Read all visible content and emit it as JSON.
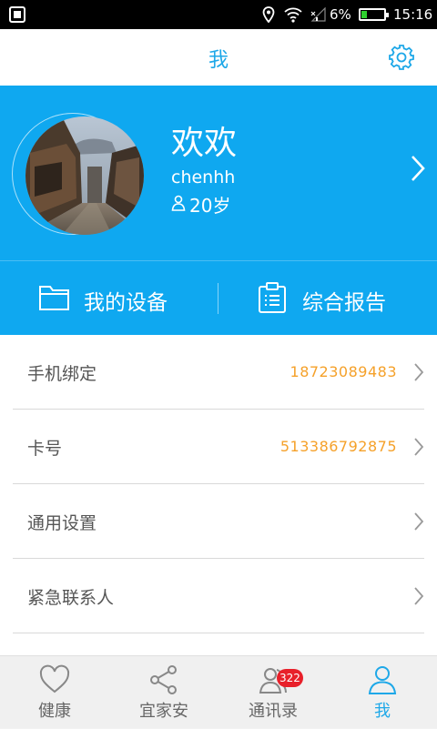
{
  "status_bar": {
    "battery": "6%",
    "battery_level": 0.06,
    "time": "15:16"
  },
  "header": {
    "title": "我"
  },
  "profile": {
    "name": "欢欢",
    "username": "chenhh",
    "age": "20岁"
  },
  "actions": [
    {
      "label": "我的设备",
      "icon": "folder-icon"
    },
    {
      "label": "综合报告",
      "icon": "report-icon"
    }
  ],
  "list": [
    {
      "label": "手机绑定",
      "value": "18723089483"
    },
    {
      "label": "卡号",
      "value": "513386792875"
    },
    {
      "label": "通用设置",
      "value": ""
    },
    {
      "label": "紧急联系人",
      "value": ""
    }
  ],
  "tabs": [
    {
      "label": "健康",
      "icon": "heart-icon",
      "active": false
    },
    {
      "label": "宜家安",
      "icon": "share-icon",
      "active": false
    },
    {
      "label": "通讯录",
      "icon": "contacts-icon",
      "badge": "322",
      "active": false
    },
    {
      "label": "我",
      "icon": "person-icon",
      "active": true
    }
  ],
  "colors": {
    "primary": "#0fa8f0",
    "accent_text": "#1ea8e8",
    "value_text": "#f5a12a",
    "badge": "#e8202a"
  }
}
